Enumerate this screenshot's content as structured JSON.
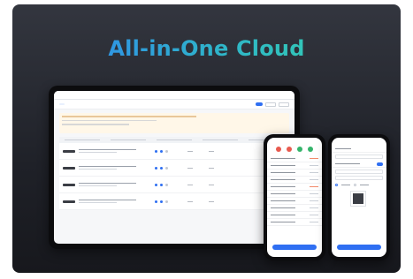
{
  "banner": {
    "title": "All-in-One Cloud",
    "gradient": [
      "#2f7df6",
      "#2fb6c8",
      "#35d6a6"
    ],
    "background": "#1f2128"
  },
  "tablet": {
    "device_rows": 4
  },
  "phone_left": {
    "status_icon_colors": [
      "#e85a4f",
      "#e85a4f",
      "#35b46b",
      "#35b46b"
    ]
  },
  "colors": {
    "accent": "#2f6ff2"
  }
}
